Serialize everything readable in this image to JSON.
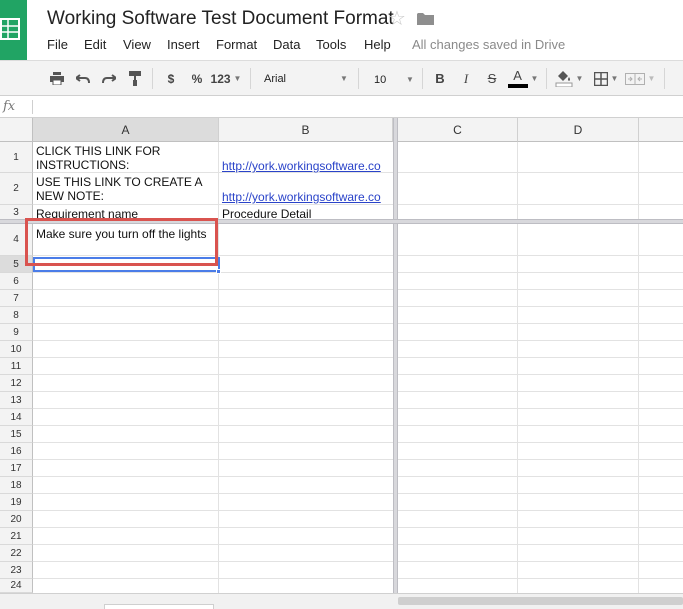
{
  "document": {
    "title": "Working Software Test Document Format",
    "save_status": "All changes saved in Drive"
  },
  "menu": [
    "File",
    "Edit",
    "View",
    "Insert",
    "Format",
    "Data",
    "Tools",
    "Help"
  ],
  "toolbar": {
    "currency_label": "$",
    "percent_label": "%",
    "number_format_label": "123",
    "font_family": "Arial",
    "font_size": "10",
    "bold_label": "B",
    "italic_label": "I",
    "strike_label": "S",
    "text_color_label": "A",
    "text_color": "#000000"
  },
  "formula_bar": {
    "fx_label": "fx",
    "value": ""
  },
  "grid": {
    "columns": [
      "A",
      "B",
      "C",
      "D"
    ],
    "rows": [
      "1",
      "2",
      "3",
      "4",
      "5",
      "6",
      "7",
      "8",
      "9",
      "10",
      "11",
      "12",
      "13",
      "14",
      "15",
      "16",
      "17",
      "18",
      "19",
      "20",
      "21",
      "22",
      "23",
      "24"
    ],
    "cells": {
      "A1": "CLICK THIS LINK FOR INSTRUCTIONS:",
      "B1": "http://york.workingsoftware.co",
      "A2": "USE THIS LINK TO CREATE A NEW NOTE:",
      "B2": "http://york.workingsoftware.co",
      "A3": "Requirement name",
      "B3": "Procedure Detail",
      "A4": "Make sure you turn off the lights"
    },
    "selected_cell": "A5",
    "link_color": "#2a43c9",
    "highlight_color": "#d9534f",
    "selection_color": "#4a7ce8"
  },
  "icons": {
    "app": "sheets-icon",
    "star": "star-icon",
    "folder": "folder-icon",
    "print": "print-icon",
    "undo": "undo-icon",
    "redo": "redo-icon",
    "paint_format": "paint-format-icon",
    "fill_color": "fill-color-icon",
    "borders": "borders-icon",
    "merge": "merge-cells-icon"
  }
}
